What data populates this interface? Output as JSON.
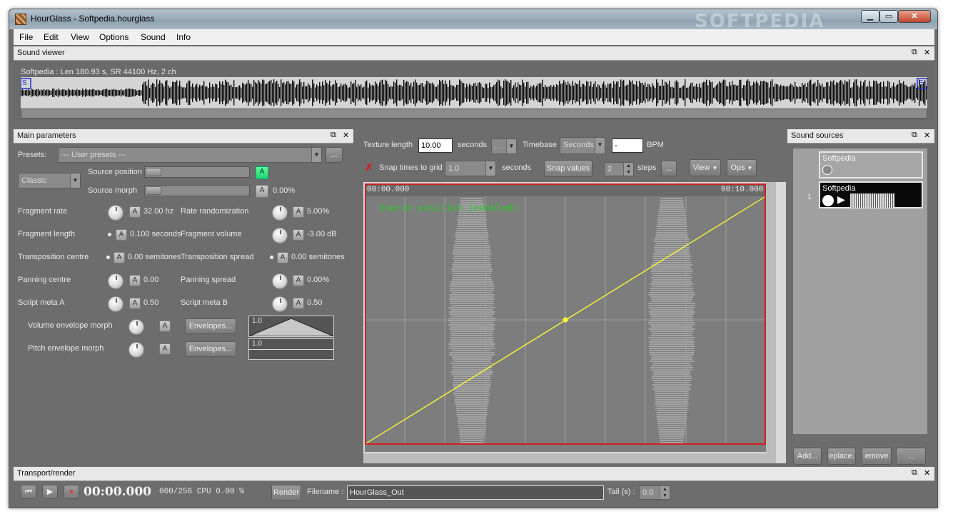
{
  "window": {
    "title": "HourGlass - Softpedia.hourglass",
    "watermark": "SOFTPEDIA",
    "min": "▁",
    "max": "▭",
    "close": "✕"
  },
  "menu": [
    "File",
    "Edit",
    "View",
    "Options",
    "Sound",
    "Info"
  ],
  "sound_viewer": {
    "header": "Sound viewer",
    "info": "Softpedia : Len 180.93 s, SR 44100 Hz, 2 ch",
    "start_marker": "S",
    "end_marker": "E"
  },
  "main_params": {
    "header": "Main parameters",
    "presets_label": "Presets:",
    "presets_value": "--- User presets ---",
    "presets_more": "...",
    "mode": "Classic",
    "source_position_label": "Source position",
    "source_position_a": "A",
    "source_morph_label": "Source morph",
    "source_morph_a": "A",
    "source_morph_value": "0.00%",
    "rows": [
      {
        "left_label": "Fragment rate",
        "left_value": "32.00 hz",
        "right_label": "Rate randomization",
        "right_value": "5.00%"
      },
      {
        "left_label": "Fragment length",
        "left_value": "0.100 seconds",
        "right_label": "Fragment volume",
        "right_value": "-3.00 dB"
      },
      {
        "left_label": "Transposition centre",
        "left_value": "0.00 semitones",
        "right_label": "Transposition spread",
        "right_value": "0.00 semitones"
      },
      {
        "left_label": "Panning centre",
        "left_value": "0.00",
        "right_label": "Panning spread",
        "right_value": "0.00%"
      },
      {
        "left_label": "Script meta A",
        "left_value": "0.50",
        "right_label": "Script meta B",
        "right_value": "0.50"
      }
    ],
    "a": "A",
    "volume_env_label": "Volume envelope morph",
    "pitch_env_label": "Pitch envelope morph",
    "envelopes_btn": "Envelopes...",
    "env_value": "1.0"
  },
  "editor": {
    "texture_length_label": "Texture length",
    "texture_length_value": "10.00",
    "seconds_label": "seconds",
    "seconds_combo": "...",
    "timebase_label": "Timebase",
    "timebase_value": "Seconds",
    "bpm_value": "-",
    "bpm_label": "BPM",
    "snap_label": "Snap times to grid",
    "snap_value": "1.0",
    "snap_seconds": "seconds",
    "snap_values_btn": "Snap values",
    "steps_value": "2",
    "steps_label": "steps",
    "more": "...",
    "view_btn": "View",
    "ops_btn": "Ops",
    "time_start": "00:00.000",
    "time_end": "00:10.000",
    "curve_label": "Source position (enabled)",
    "line_color": "#ffff33",
    "border_color": "#d02020"
  },
  "sound_sources": {
    "header": "Sound sources",
    "items": [
      {
        "index": "",
        "name": "Softpedia"
      },
      {
        "index": "1",
        "name": "Softpedia"
      }
    ],
    "add_btn": "Add...",
    "replace_btn": "eplace.",
    "remove_btn": "emove",
    "more_btn": "..."
  },
  "transport": {
    "header": "Transport/render",
    "time": "00:00.000",
    "cpu": "000/256 CPU 0.00 %",
    "render_btn": "Render",
    "filename_label": "Filename :",
    "filename_value": "HourGlass_Out",
    "tail_label": "Tail (s) :",
    "tail_value": "0.0"
  }
}
